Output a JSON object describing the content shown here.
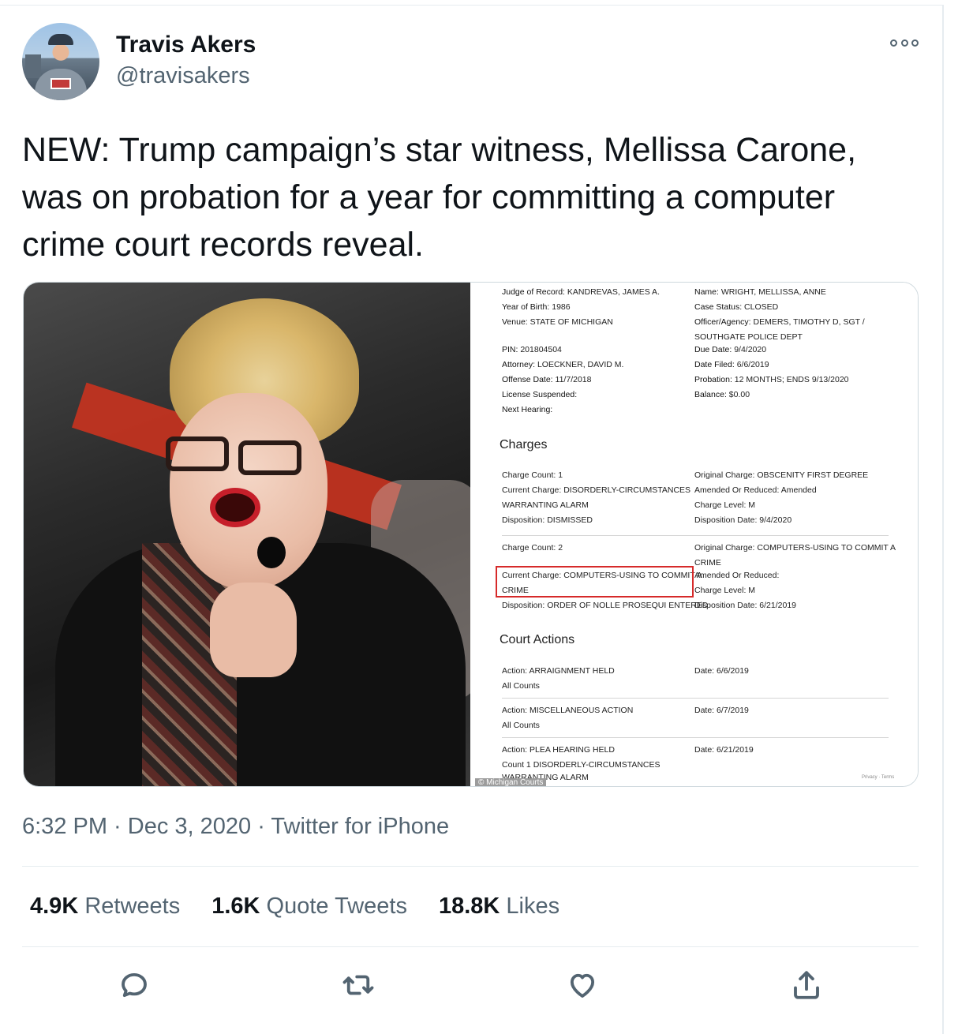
{
  "author": {
    "display_name": "Travis Akers",
    "handle": "@travisakers"
  },
  "tweet": {
    "text": "NEW: Trump campaign’s star witness, Mellissa Carone, was on probation for a year for committing a computer crime court records reveal."
  },
  "media": {
    "court_record": {
      "left_fields": [
        {
          "label": "Judge of Record:",
          "value": "KANDREVAS, JAMES A."
        },
        {
          "label": "Year of Birth:",
          "value": "1986"
        },
        {
          "label": "Venue:",
          "value": "STATE OF MICHIGAN"
        },
        {
          "label": "PIN:",
          "value": "201804504"
        },
        {
          "label": "Attorney:",
          "value": "LOECKNER, DAVID M."
        },
        {
          "label": "Offense Date:",
          "value": "11/7/2018"
        },
        {
          "label": "License Suspended:",
          "value": ""
        },
        {
          "label": "Next Hearing:",
          "value": ""
        }
      ],
      "right_fields": [
        {
          "label": "Name:",
          "value": "WRIGHT, MELLISSA, ANNE"
        },
        {
          "label": "Case Status:",
          "value": "CLOSED"
        },
        {
          "label": "Officer/Agency:",
          "value": "DEMERS, TIMOTHY D, SGT /"
        },
        {
          "label": "",
          "value": "SOUTHGATE POLICE DEPT"
        },
        {
          "label": "Due Date:",
          "value": "9/4/2020"
        },
        {
          "label": "Date Filed:",
          "value": "6/6/2019"
        },
        {
          "label": "Probation:",
          "value": "12 MONTHS; ENDS 9/13/2020"
        },
        {
          "label": "Balance:",
          "value": "$0.00"
        }
      ],
      "charges_heading": "Charges",
      "charge1": {
        "count": "Charge Count: 1",
        "current": "Current Charge: DISORDERLY-CIRCUMSTANCES",
        "current_cont": "WARRANTING ALARM",
        "disposition": "Disposition: DISMISSED",
        "original": "Original Charge: OBSCENITY FIRST DEGREE",
        "amended": "Amended Or Reduced: Amended",
        "level": "Charge Level: M",
        "disposition_date": "Disposition Date: 9/4/2020"
      },
      "charge2": {
        "count": "Charge Count: 2",
        "current": "Current Charge: COMPUTERS-USING TO COMMIT A",
        "current_cont": "CRIME",
        "disposition": "Disposition: ORDER OF NOLLE PROSEQUI ENTERED",
        "original": "Original Charge: COMPUTERS-USING TO COMMIT A",
        "original_cont": "CRIME",
        "amended": "Amended Or Reduced:",
        "level": "Charge Level: M",
        "disposition_date": "Disposition Date: 6/21/2019"
      },
      "actions_heading": "Court Actions",
      "actions": [
        {
          "action": "Action: ARRAIGNMENT HELD",
          "detail": "All Counts",
          "date": "Date: 6/6/2019"
        },
        {
          "action": "Action: MISCELLANEOUS ACTION",
          "detail": "All Counts",
          "date": "Date: 6/7/2019"
        },
        {
          "action": "Action: PLEA HEARING HELD",
          "detail": "Count 1 DISORDERLY-CIRCUMSTANCES",
          "detail2": "WARRANTING ALARM",
          "date": "Date: 6/21/2019"
        }
      ],
      "credit": "© Michigan Courts",
      "footer": "Privacy · Terms"
    }
  },
  "meta": {
    "time": "6:32 PM",
    "sep1": " · ",
    "date": "Dec 3, 2020",
    "sep2": " · ",
    "source": "Twitter for iPhone"
  },
  "stats": {
    "retweets_count": "4.9K",
    "retweets_label": "Retweets",
    "quotes_count": "1.6K",
    "quotes_label": "Quote Tweets",
    "likes_count": "18.8K",
    "likes_label": "Likes"
  },
  "icons": {
    "reply": "reply-icon",
    "retweet": "retweet-icon",
    "like": "heart-icon",
    "share": "share-icon",
    "more": "more-icon"
  },
  "colors": {
    "text_primary": "#0f1419",
    "text_secondary": "#536471",
    "divider": "#e6ecf0",
    "highlight_box": "#d62a2a"
  }
}
